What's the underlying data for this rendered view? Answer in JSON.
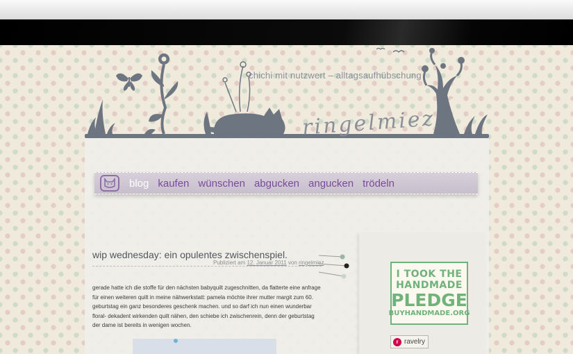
{
  "header": {
    "tagline": "chichi mit nutzwert – alltagsaufhübschung",
    "logo_text": "ringelmiez"
  },
  "nav": {
    "items": [
      {
        "label": "blog",
        "active": true
      },
      {
        "label": "kaufen",
        "active": false
      },
      {
        "label": "wünschen",
        "active": false
      },
      {
        "label": "abgucken",
        "active": false
      },
      {
        "label": "angucken",
        "active": false
      },
      {
        "label": "trödeln",
        "active": false
      }
    ]
  },
  "post": {
    "title": "wip wednesday: ein opulentes zwischenspiel.",
    "meta_prefix": "Publiziert am ",
    "date": "12. Januar 2011",
    "meta_by": " von ",
    "author": "ringelmiez",
    "body": "gerade hatte ich die stoffe für den nächsten babyquilt zugeschnitten, da flatterte eine anfrage für einen weiteren quilt in meine nähwerkstatt: pamela möchte ihrer mutter margit zum 60. geburtstag ein ganz besonderes geschenk machen. und so darf ich nun einen wunderbar floral- dekadent wirkenden quilt nähen, den schiebe ich zwischenrein, denn der geburtstag der dame ist bereits in wenigen wochen."
  },
  "sidebar": {
    "pledge": {
      "line1": "I TOOK THE",
      "line2": "HANDMADE",
      "line3": "PLEDGE",
      "line4": "BUYHANDMADE.ORG"
    },
    "ravelry_label": "ravelry"
  },
  "colors": {
    "nav_active": "#ffffff",
    "nav_link": "#7a4b98",
    "pledge_green": "#6fb27a",
    "silhouette": "#6d7580"
  },
  "icons": [
    "cat-face-icon",
    "ravelry-icon",
    "pins-icon",
    "butterfly-icon",
    "flower-icon",
    "cat-silhouette-icon",
    "tree-icon"
  ]
}
